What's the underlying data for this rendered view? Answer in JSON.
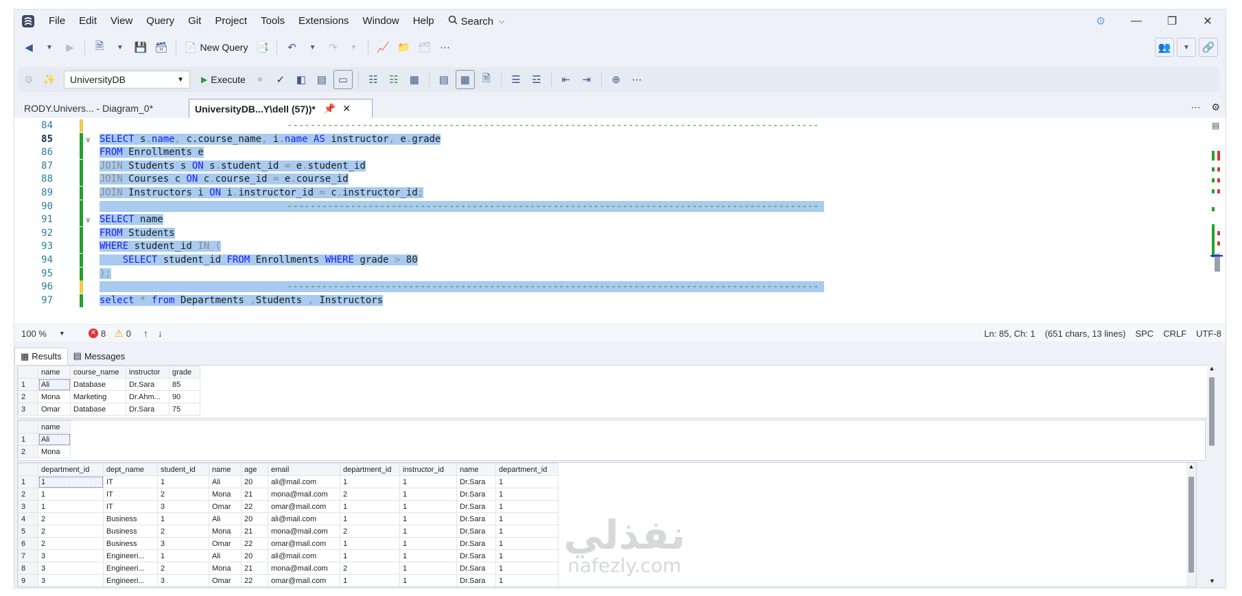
{
  "menu": [
    "File",
    "Edit",
    "View",
    "Query",
    "Git",
    "Project",
    "Tools",
    "Extensions",
    "Window",
    "Help"
  ],
  "search_label": "Search",
  "toolbar1": {
    "new_query_label": "New Query"
  },
  "toolbar2": {
    "database": "UniversityDB",
    "execute_label": "Execute"
  },
  "tabs": {
    "inactive": "RODY.Univers... - Diagram_0*",
    "active": "UniversityDB...Y\\dell (57))*"
  },
  "editor": {
    "lines": [
      {
        "n": "84",
        "t": "dash",
        "text": "--------------------------------------------------------------------------------------------",
        "sel": false
      },
      {
        "n": "85",
        "t": "code",
        "fold": true,
        "parts": [
          [
            "kw",
            "SELECT "
          ],
          [
            "",
            "s"
          ],
          [
            "gr",
            "."
          ],
          [
            "kw",
            "name"
          ],
          [
            "gr",
            ", "
          ],
          [
            "",
            "c.course_name"
          ],
          [
            "gr",
            ", "
          ],
          [
            "",
            "i"
          ],
          [
            "gr",
            "."
          ],
          [
            "kw",
            "name "
          ],
          [
            "kw",
            "AS "
          ],
          [
            "",
            "instructor"
          ],
          [
            "gr",
            ", "
          ],
          [
            "",
            "e"
          ],
          [
            "gr",
            "."
          ],
          [
            "",
            "grade"
          ]
        ],
        "sel": true
      },
      {
        "n": "86",
        "t": "code",
        "parts": [
          [
            "kw",
            "FROM "
          ],
          [
            "",
            "Enrollments e"
          ]
        ],
        "sel": true
      },
      {
        "n": "87",
        "t": "code",
        "parts": [
          [
            "gr",
            "JOIN "
          ],
          [
            "",
            "Students s "
          ],
          [
            "kw",
            "ON "
          ],
          [
            "",
            "s"
          ],
          [
            "gr",
            "."
          ],
          [
            "",
            "student_id "
          ],
          [
            "gr",
            "= "
          ],
          [
            "",
            "e"
          ],
          [
            "gr",
            "."
          ],
          [
            "",
            "student_id"
          ]
        ],
        "sel": true
      },
      {
        "n": "88",
        "t": "code",
        "parts": [
          [
            "gr",
            "JOIN "
          ],
          [
            "",
            "Courses c "
          ],
          [
            "kw",
            "ON "
          ],
          [
            "",
            "c"
          ],
          [
            "gr",
            "."
          ],
          [
            "",
            "course_id "
          ],
          [
            "gr",
            "= "
          ],
          [
            "",
            "e"
          ],
          [
            "gr",
            "."
          ],
          [
            "",
            "course_id"
          ]
        ],
        "sel": true
      },
      {
        "n": "89",
        "t": "code",
        "parts": [
          [
            "gr",
            "JOIN "
          ],
          [
            "",
            "Instructors i "
          ],
          [
            "kw",
            "ON "
          ],
          [
            "",
            "i"
          ],
          [
            "gr",
            "."
          ],
          [
            "",
            "instructor_id "
          ],
          [
            "gr",
            "= "
          ],
          [
            "",
            "c"
          ],
          [
            "gr",
            "."
          ],
          [
            "",
            "instructor_id"
          ],
          [
            "gr",
            ";"
          ]
        ],
        "sel": true
      },
      {
        "n": "90",
        "t": "dash",
        "text": "--------------------------------------------------------------------------------------------",
        "sel": true
      },
      {
        "n": "91",
        "t": "code",
        "fold": true,
        "parts": [
          [
            "kw",
            "SELECT "
          ],
          [
            "",
            "name"
          ]
        ],
        "sel": true
      },
      {
        "n": "92",
        "t": "code",
        "parts": [
          [
            "kw",
            "FROM "
          ],
          [
            "",
            "Students"
          ]
        ],
        "sel": true
      },
      {
        "n": "93",
        "t": "code",
        "parts": [
          [
            "kw",
            "WHERE "
          ],
          [
            "",
            "student_id "
          ],
          [
            "gr",
            "IN ("
          ]
        ],
        "sel": true
      },
      {
        "n": "94",
        "t": "code",
        "parts": [
          [
            "",
            "    "
          ],
          [
            "kw",
            "SELECT "
          ],
          [
            "",
            "student_id "
          ],
          [
            "kw",
            "FROM "
          ],
          [
            "",
            "Enrollments "
          ],
          [
            "kw",
            "WHERE "
          ],
          [
            "",
            "grade "
          ],
          [
            "gr",
            "> "
          ],
          [
            "",
            "80"
          ]
        ],
        "sel": true
      },
      {
        "n": "95",
        "t": "code",
        "parts": [
          [
            "gr",
            ");"
          ]
        ],
        "sel": true
      },
      {
        "n": "96",
        "t": "dash",
        "text": "--------------------------------------------------------------------------------------------",
        "sel": true
      },
      {
        "n": "97",
        "t": "code",
        "parts": [
          [
            "kw",
            "select "
          ],
          [
            "gr",
            "* "
          ],
          [
            "kw",
            "from "
          ],
          [
            "",
            "Departments "
          ],
          [
            "gr",
            ","
          ],
          [
            "",
            "Students "
          ],
          [
            "gr",
            ", "
          ],
          [
            "",
            "Instructors"
          ]
        ],
        "sel": true
      }
    ]
  },
  "status": {
    "zoom": "100 %",
    "errors": "8",
    "warnings": "0",
    "position": "Ln: 85, Ch: 1",
    "chars": "(651 chars, 13 lines)",
    "spc": "SPC",
    "crlf": "CRLF",
    "encoding": "UTF-8"
  },
  "results": {
    "tab_results": "Results",
    "tab_messages": "Messages"
  },
  "grid1": {
    "headers": [
      "name",
      "course_name",
      "instructor",
      "grade"
    ],
    "rows": [
      [
        "1",
        "Ali",
        "Database",
        "Dr.Sara",
        "85"
      ],
      [
        "2",
        "Mona",
        "Marketing",
        "Dr.Ahm...",
        "90"
      ],
      [
        "3",
        "Omar",
        "Database",
        "Dr.Sara",
        "75"
      ]
    ]
  },
  "grid2": {
    "headers": [
      "name"
    ],
    "rows": [
      [
        "1",
        "Ali"
      ],
      [
        "2",
        "Mona"
      ]
    ]
  },
  "grid3": {
    "headers": [
      "department_id",
      "dept_name",
      "student_id",
      "name",
      "age",
      "email",
      "department_id",
      "instructor_id",
      "name",
      "department_id"
    ],
    "rows": [
      [
        "1",
        "1",
        "IT",
        "1",
        "Ali",
        "20",
        "ali@mail.com",
        "1",
        "1",
        "Dr.Sara",
        "1"
      ],
      [
        "2",
        "1",
        "IT",
        "2",
        "Mona",
        "21",
        "mona@mail.com",
        "2",
        "1",
        "Dr.Sara",
        "1"
      ],
      [
        "3",
        "1",
        "IT",
        "3",
        "Omar",
        "22",
        "omar@mail.com",
        "1",
        "1",
        "Dr.Sara",
        "1"
      ],
      [
        "4",
        "2",
        "Business",
        "1",
        "Ali",
        "20",
        "ali@mail.com",
        "1",
        "1",
        "Dr.Sara",
        "1"
      ],
      [
        "5",
        "2",
        "Business",
        "2",
        "Mona",
        "21",
        "mona@mail.com",
        "2",
        "1",
        "Dr.Sara",
        "1"
      ],
      [
        "6",
        "2",
        "Business",
        "3",
        "Omar",
        "22",
        "omar@mail.com",
        "1",
        "1",
        "Dr.Sara",
        "1"
      ],
      [
        "7",
        "3",
        "Engineeri...",
        "1",
        "Ali",
        "20",
        "ali@mail.com",
        "1",
        "1",
        "Dr.Sara",
        "1"
      ],
      [
        "8",
        "3",
        "Engineeri...",
        "2",
        "Mona",
        "21",
        "mona@mail.com",
        "2",
        "1",
        "Dr.Sara",
        "1"
      ],
      [
        "9",
        "3",
        "Engineeri...",
        "3",
        "Omar",
        "22",
        "omar@mail.com",
        "1",
        "1",
        "Dr.Sara",
        "1"
      ]
    ]
  },
  "watermark": {
    "arabic": "نفذلي",
    "latin": "nafezly.com"
  },
  "colors": {
    "selection": "#a8cbef",
    "keyword": "#1a1aff",
    "comment_dash": "#3e8e3e",
    "line_number": "#2b7d9e",
    "error": "#e03434",
    "warning": "#f0a020"
  }
}
